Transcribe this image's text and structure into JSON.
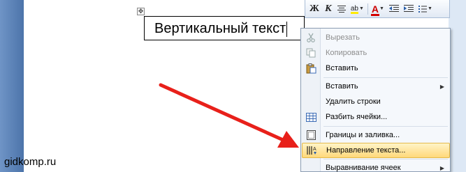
{
  "document": {
    "cell_text": "Вертикальный текст"
  },
  "mini_toolbar": {
    "bold": "Ж",
    "italic": "К",
    "highlight": "ab",
    "font_color": "A",
    "icons": [
      "bold-icon",
      "italic-icon",
      "align-center-icon",
      "highlight-icon",
      "font-color-icon",
      "decrease-indent-icon",
      "increase-indent-icon",
      "bullets-icon"
    ]
  },
  "context_menu": {
    "items": [
      {
        "label": "Вырезать",
        "icon": "cut-icon",
        "disabled": true
      },
      {
        "label": "Копировать",
        "icon": "copy-icon",
        "disabled": true
      },
      {
        "label": "Вставить",
        "icon": "paste-icon",
        "disabled": false
      },
      {
        "label": "Вставить",
        "icon": "",
        "disabled": false,
        "submenu": true
      },
      {
        "label": "Удалить строки",
        "icon": "",
        "disabled": false
      },
      {
        "label": "Разбить ячейки...",
        "icon": "split-cells-icon",
        "disabled": false
      },
      {
        "label": "Границы и заливка...",
        "icon": "borders-icon",
        "disabled": false
      },
      {
        "label": "Направление текста...",
        "icon": "text-direction-icon",
        "disabled": false,
        "highlighted": true
      },
      {
        "label": "Выравнивание ячеек",
        "icon": "",
        "disabled": false,
        "submenu": true
      }
    ]
  },
  "watermark": "gidkomp.ru",
  "colors": {
    "arrow": "#e8201a",
    "menu_highlight": "#ffd87a",
    "sidebar": "#5b82b5"
  }
}
